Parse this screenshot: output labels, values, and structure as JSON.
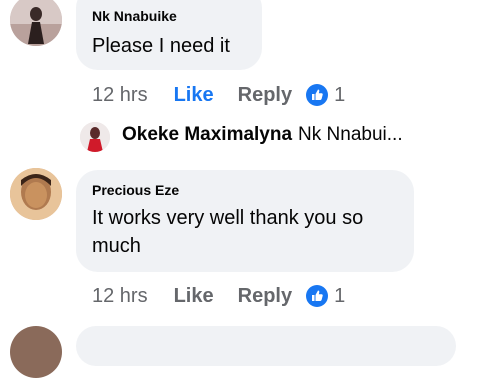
{
  "comments": [
    {
      "author": "Nk Nnabuike",
      "text": "Please I need it",
      "time": "12 hrs",
      "like_label": "Like",
      "reply_label": "Reply",
      "reaction_count": "1",
      "reaction_icon": "thumbs-up-icon"
    },
    {
      "author": "Precious Eze",
      "text": "It works very well thank you so much",
      "time": "12 hrs",
      "like_label": "Like",
      "reply_label": "Reply",
      "reaction_count": "1",
      "reaction_icon": "thumbs-up-icon"
    }
  ],
  "reply_preview": {
    "author": "Okeke Maximalyna",
    "text": "Nk Nnabui..."
  },
  "colors": {
    "like_blue": "#1877f2",
    "bubble_gray": "#f0f2f5",
    "meta_gray": "#65676b"
  }
}
